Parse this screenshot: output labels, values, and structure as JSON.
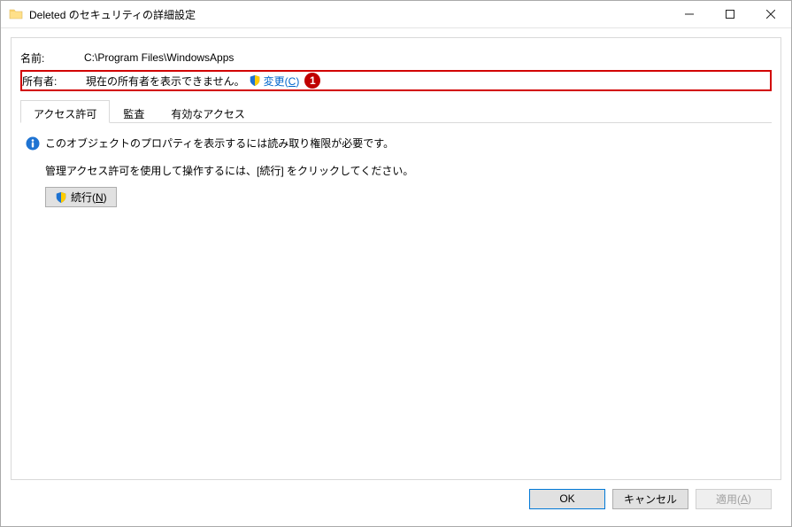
{
  "titlebar": {
    "title": "Deleted のセキュリティの詳細設定"
  },
  "header": {
    "name_label": "名前:",
    "name_value": "C:\\Program Files\\WindowsApps",
    "owner_label": "所有者:",
    "owner_value": "現在の所有者を表示できません。",
    "change_prefix": "変更(",
    "change_key": "C",
    "change_suffix": ")",
    "annotation": "1"
  },
  "tabs": {
    "permissions": "アクセス許可",
    "audit": "監査",
    "effective": "有効なアクセス"
  },
  "messages": {
    "info1": "このオブジェクトのプロパティを表示するには読み取り権限が必要です。",
    "info2": "管理アクセス許可を使用して操作するには、[続行] をクリックしてください。",
    "continue_prefix": "続行(",
    "continue_key": "N",
    "continue_suffix": ")"
  },
  "footer": {
    "ok": "OK",
    "cancel": "キャンセル",
    "apply_prefix": "適用(",
    "apply_key": "A",
    "apply_suffix": ")"
  }
}
